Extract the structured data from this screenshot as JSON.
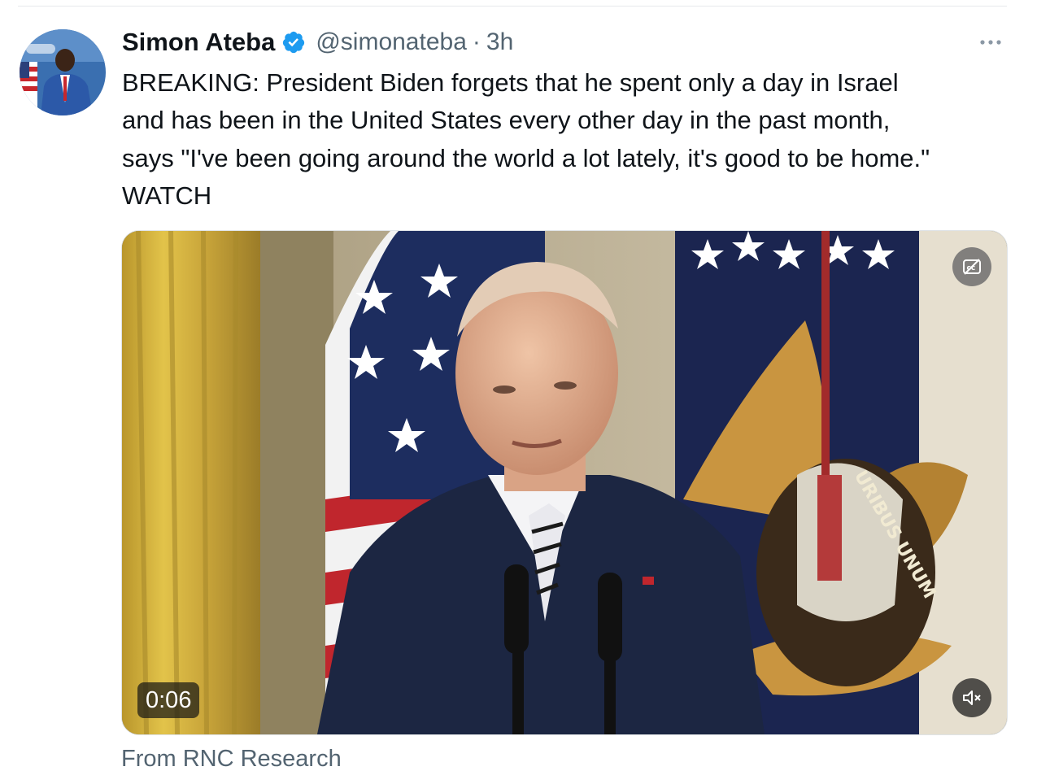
{
  "tweet": {
    "author_name": "Simon Ateba",
    "author_handle": "@simonateba",
    "separator": "·",
    "time": "3h",
    "text": "BREAKING: President Biden forgets that he spent only a day in Israel\nand has been in the United States every other day in the past month,\nsays \"I've been going around the world a lot lately, it's good to be home.\"\nWATCH"
  },
  "video": {
    "timestamp": "0:06",
    "caption_icon": "closed-captions-off-icon",
    "mute_icon": "speaker-muted-icon",
    "source_label": "From RNC Research"
  },
  "icons": {
    "verified": "verified-badge-icon",
    "more": "more-options-icon"
  },
  "colors": {
    "verified_blue": "#1d9bf0",
    "secondary_text": "#536471",
    "primary_text": "#0f1419"
  }
}
